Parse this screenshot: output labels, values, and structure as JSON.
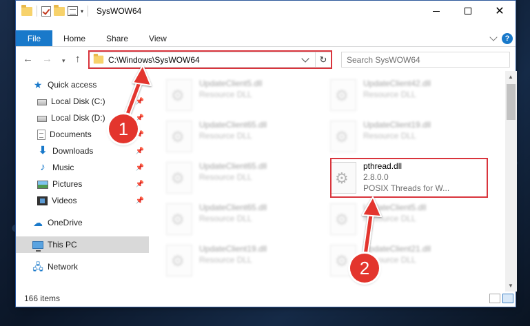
{
  "window": {
    "title": "SysWOW64"
  },
  "ribbon": {
    "tabs": [
      {
        "label": "File"
      },
      {
        "label": "Home"
      },
      {
        "label": "Share"
      },
      {
        "label": "View"
      }
    ],
    "help_label": "?"
  },
  "nav": {
    "back": "←",
    "forward": "→",
    "recent": "▾",
    "up": "↑"
  },
  "address": {
    "path": "C:\\Windows\\SysWOW64",
    "refresh": "↻"
  },
  "search": {
    "placeholder": "Search SysWOW64"
  },
  "sidebar": {
    "items": [
      {
        "label": "Quick access",
        "icon": "star-icon"
      },
      {
        "label": "Local Disk (C:)",
        "icon": "drive-icon",
        "pinned": true
      },
      {
        "label": "Local Disk (D:)",
        "icon": "drive-icon",
        "pinned": true
      },
      {
        "label": "Documents",
        "icon": "documents-icon",
        "pinned": true
      },
      {
        "label": "Downloads",
        "icon": "download-icon",
        "pinned": true
      },
      {
        "label": "Music",
        "icon": "music-icon",
        "pinned": true
      },
      {
        "label": "Pictures",
        "icon": "pictures-icon",
        "pinned": true
      },
      {
        "label": "Videos",
        "icon": "videos-icon",
        "pinned": true
      },
      {
        "label": "OneDrive",
        "icon": "cloud-icon"
      },
      {
        "label": "This PC",
        "icon": "computer-icon",
        "selected": true
      },
      {
        "label": "Network",
        "icon": "network-icon"
      }
    ]
  },
  "files": [
    {
      "name": "UpdateClient5.dll",
      "type": "Resource DLL"
    },
    {
      "name": "UpdateClient42.dll",
      "type": "Resource DLL"
    },
    {
      "name": "UpdateClient65.dll",
      "type": "Resource DLL"
    },
    {
      "name": "UpdateClient19.dll",
      "type": "Resource DLL"
    },
    {
      "name": "UpdateClient65.dll",
      "type": "Resource DLL"
    },
    {
      "name": "pthread.dll",
      "version": "2.8.0.0",
      "type": "POSIX Threads for W..."
    },
    {
      "name": "UpdateClient65.dll",
      "type": "Resource DLL"
    },
    {
      "name": "UpdateClient5.dll",
      "type": "Resource DLL"
    },
    {
      "name": "UpdateClient19.dll",
      "type": "Resource DLL"
    },
    {
      "name": "UpdateClient21.dll",
      "type": "Resource DLL"
    }
  ],
  "status": {
    "item_count": "166 items"
  },
  "annotations": {
    "step1": "1",
    "step2": "2",
    "color": "#e3352d"
  },
  "colors": {
    "accent": "#1979ca",
    "highlight": "#d9343c",
    "selected_nav": "#d9d9d9"
  }
}
